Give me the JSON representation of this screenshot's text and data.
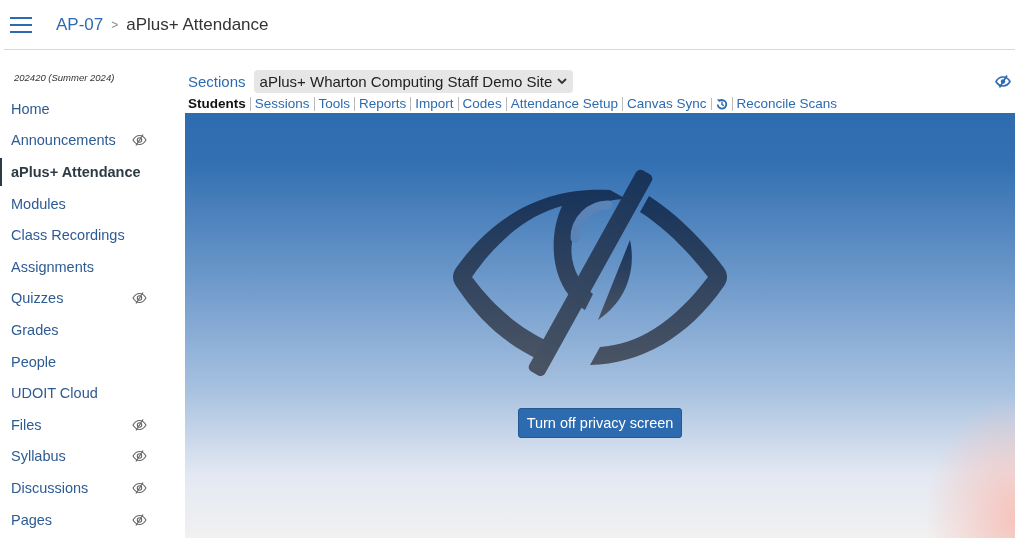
{
  "header": {
    "course": "AP-07",
    "separator": ">",
    "page": "aPlus+ Attendance"
  },
  "sidebar": {
    "term": "202420 (Summer 2024)",
    "items": [
      {
        "label": "Home",
        "selected": false,
        "hidden": false
      },
      {
        "label": "Announcements",
        "selected": false,
        "hidden": true
      },
      {
        "label": "aPlus+ Attendance",
        "selected": true,
        "hidden": false
      },
      {
        "label": "Modules",
        "selected": false,
        "hidden": false
      },
      {
        "label": "Class Recordings",
        "selected": false,
        "hidden": false
      },
      {
        "label": "Assignments",
        "selected": false,
        "hidden": false
      },
      {
        "label": "Quizzes",
        "selected": false,
        "hidden": true
      },
      {
        "label": "Grades",
        "selected": false,
        "hidden": false
      },
      {
        "label": "People",
        "selected": false,
        "hidden": false
      },
      {
        "label": "UDOIT Cloud",
        "selected": false,
        "hidden": false
      },
      {
        "label": "Files",
        "selected": false,
        "hidden": true
      },
      {
        "label": "Syllabus",
        "selected": false,
        "hidden": true
      },
      {
        "label": "Discussions",
        "selected": false,
        "hidden": true
      },
      {
        "label": "Pages",
        "selected": false,
        "hidden": true
      }
    ]
  },
  "sections": {
    "label": "Sections",
    "value": "aPlus+ Wharton Computing Staff Demo Site"
  },
  "tabs": [
    {
      "kind": "text",
      "label": "Students",
      "selected": true
    },
    {
      "kind": "text",
      "label": "Sessions",
      "selected": false
    },
    {
      "kind": "text",
      "label": "Tools",
      "selected": false
    },
    {
      "kind": "text",
      "label": "Reports",
      "selected": false
    },
    {
      "kind": "text",
      "label": "Import",
      "selected": false
    },
    {
      "kind": "text",
      "label": "Codes",
      "selected": false
    },
    {
      "kind": "text",
      "label": "Attendance Setup",
      "selected": false
    },
    {
      "kind": "text",
      "label": "Canvas Sync",
      "selected": false
    },
    {
      "kind": "icon",
      "selected": false
    },
    {
      "kind": "text",
      "label": "Reconcile Scans",
      "selected": false
    }
  ],
  "privacy_screen": {
    "on": true,
    "button": "Turn off privacy screen"
  }
}
